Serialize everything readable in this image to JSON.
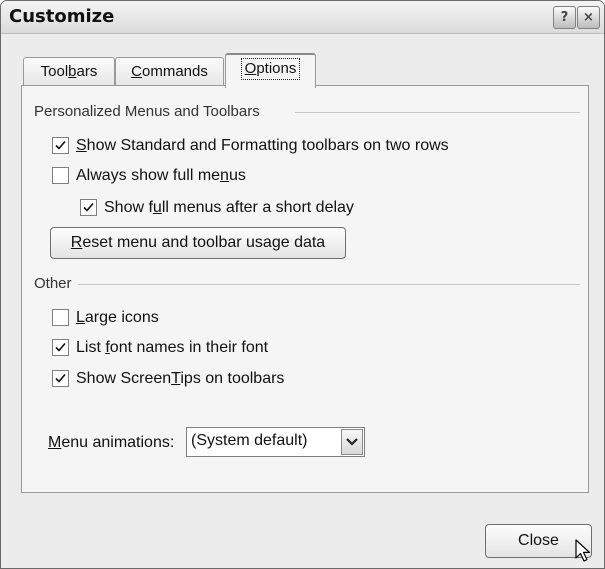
{
  "window": {
    "title": "Customize",
    "help_glyph": "?",
    "close_glyph": "×"
  },
  "tabs": [
    {
      "pre": "Tool",
      "key": "b",
      "post": "ars",
      "active": false
    },
    {
      "pre": "",
      "key": "C",
      "post": "ommands",
      "active": false
    },
    {
      "pre": "",
      "key": "O",
      "post": "ptions",
      "active": true
    }
  ],
  "personalized": {
    "group_label": "Personalized Menus and Toolbars",
    "options": [
      {
        "pre": "",
        "key": "S",
        "post": "how Standard and Formatting toolbars on two rows",
        "checked": true
      },
      {
        "pre": "Always show full me",
        "key": "n",
        "post": "us",
        "checked": false
      },
      {
        "pre": "Show f",
        "key": "u",
        "post": "ll menus after a short delay",
        "checked": true
      }
    ],
    "reset_button": {
      "pre": "",
      "key": "R",
      "post": "eset menu and toolbar usage data"
    }
  },
  "other": {
    "group_label": "Other",
    "options": [
      {
        "pre": "",
        "key": "L",
        "post": "arge icons",
        "checked": false
      },
      {
        "pre": "List ",
        "key": "f",
        "post": "ont names in their font",
        "checked": true
      },
      {
        "pre": "Show Screen",
        "key": "T",
        "post": "ips on toolbars",
        "checked": true
      }
    ]
  },
  "menu_animations": {
    "label_pre": "",
    "label_key": "M",
    "label_post": "enu animations:",
    "value": "(System default)"
  },
  "footer": {
    "close_label": "Close"
  },
  "icons": {
    "checkmark": "checkmark-icon",
    "dropdown": "chevron-down-icon",
    "cursor": "mouse-pointer-icon"
  }
}
